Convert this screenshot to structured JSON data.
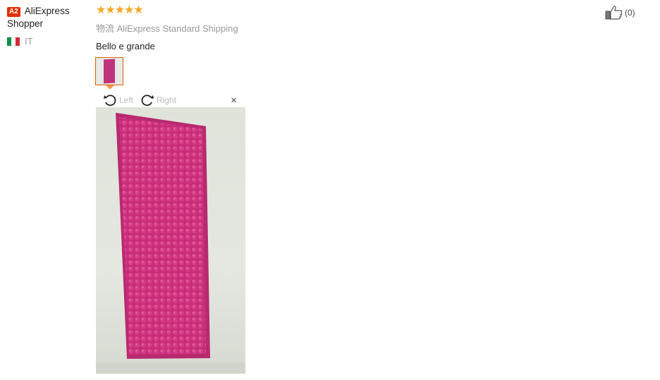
{
  "user": {
    "badge": "A2",
    "name": "AliExpress Shopper",
    "country_code": "IT",
    "flag_colors": [
      "#009246",
      "#ffffff",
      "#ce2b37"
    ]
  },
  "review": {
    "rating_stars": 5,
    "stars_text": "★★★★★",
    "shipping": "物流 AliExpress Standard Shipping",
    "text": "Bello e grande",
    "colors": {
      "star": "#f5a623",
      "accent_border": "#e65c00"
    }
  },
  "viewer": {
    "rotate_left_label": "Left",
    "rotate_right_label": "Right",
    "close_label": "×"
  },
  "helpful": {
    "count_label": "(0)"
  }
}
